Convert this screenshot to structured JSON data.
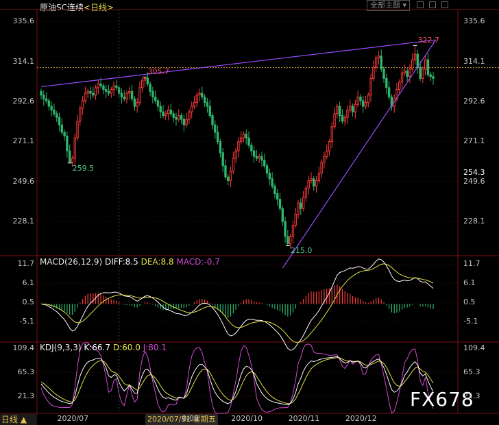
{
  "header": {
    "instrument": "原油SC连续",
    "period_tag": "<日线>",
    "theme_button": "全部主题",
    "dropdown_icon": "triangle-down-icon"
  },
  "colors": {
    "up": "#ff3b3b",
    "down": "#2eb86e",
    "trendline": "#9a4dff",
    "level_line": "#d39a2a",
    "axis_text": "#c8c8c8",
    "grid": "#3a1010",
    "macd_diff": "#ffffff",
    "macd_dea": "#e6e24a",
    "macd_hist_up": "#ff3b3b",
    "macd_hist_down": "#2eb86e",
    "kdj_k": "#ffffff",
    "kdj_d": "#e6e24a",
    "kdj_j": "#d04bd0",
    "current_price_label": "#ffffff"
  },
  "chart_data": [
    {
      "type": "candlestick",
      "panel": "price",
      "y_ticks": [
        "335.6",
        "314.1",
        "292.6",
        "271.1",
        "249.6",
        "228.1"
      ],
      "y_tick_values": [
        335.6,
        314.1,
        292.6,
        271.1,
        249.6,
        228.1
      ],
      "ylim": [
        210.0,
        342.0
      ],
      "current_price": "254.3",
      "reference_level": 310.8,
      "annotations": [
        {
          "text": "322.7",
          "value": 322.7,
          "kind": "high"
        },
        {
          "text": "305.7",
          "value": 305.7,
          "kind": "high"
        },
        {
          "text": "259.5",
          "value": 259.5,
          "kind": "low"
        },
        {
          "text": "215.0",
          "value": 215.0,
          "kind": "low"
        }
      ],
      "trendlines": [
        {
          "name": "upper",
          "from_index": 0,
          "from_value": 300.5,
          "to_index": 152,
          "to_value": 325.7
        },
        {
          "name": "lower",
          "from_index": 93,
          "from_value": 203.0,
          "to_index": 152,
          "to_value": 325.7
        }
      ],
      "close": [
        296,
        294,
        293,
        290,
        288,
        286,
        284,
        280,
        276,
        274,
        266,
        260,
        262,
        273,
        282,
        289,
        293,
        297,
        298,
        297,
        296,
        300,
        302,
        301,
        299,
        298,
        297,
        299,
        301,
        300,
        297,
        295,
        294,
        297,
        298,
        294,
        290,
        292,
        300,
        304,
        305,
        302,
        298,
        295,
        293,
        290,
        287,
        285,
        286,
        288,
        286,
        284,
        283,
        285,
        283,
        280,
        283,
        287,
        290,
        292,
        296,
        297,
        295,
        292,
        290,
        285,
        280,
        276,
        271,
        265,
        258,
        252,
        250,
        255,
        262,
        266,
        271,
        273,
        275,
        273,
        269,
        266,
        263,
        262,
        263,
        261,
        258,
        254,
        251,
        247,
        243,
        240,
        235,
        228,
        220,
        216,
        220,
        226,
        232,
        238,
        235,
        241,
        246,
        250,
        251,
        247,
        250,
        254,
        260,
        263,
        266,
        271,
        279,
        286,
        290,
        285,
        282,
        284,
        288,
        290,
        287,
        291,
        295,
        293,
        290,
        292,
        296,
        305,
        311,
        316,
        317,
        310,
        305,
        300,
        295,
        290,
        294,
        299,
        303,
        308,
        309,
        306,
        310,
        315,
        318,
        311,
        305,
        310,
        315,
        307,
        306,
        305
      ],
      "open": [
        298,
        296,
        294,
        293,
        290,
        288,
        286,
        284,
        280,
        276,
        274,
        266,
        260,
        262,
        273,
        282,
        289,
        293,
        297,
        298,
        297,
        296,
        300,
        302,
        301,
        299,
        298,
        297,
        299,
        301,
        300,
        297,
        295,
        294,
        297,
        298,
        294,
        290,
        292,
        300,
        304,
        305,
        302,
        298,
        295,
        293,
        290,
        287,
        285,
        286,
        288,
        286,
        284,
        283,
        285,
        283,
        280,
        283,
        287,
        290,
        292,
        296,
        297,
        295,
        292,
        290,
        285,
        280,
        276,
        271,
        265,
        258,
        252,
        250,
        255,
        262,
        266,
        271,
        273,
        275,
        273,
        269,
        266,
        263,
        262,
        263,
        261,
        258,
        254,
        251,
        247,
        243,
        240,
        235,
        228,
        220,
        216,
        220,
        226,
        232,
        238,
        235,
        241,
        246,
        250,
        251,
        247,
        250,
        254,
        260,
        263,
        266,
        271,
        279,
        286,
        290,
        285,
        282,
        284,
        288,
        290,
        287,
        291,
        295,
        293,
        290,
        292,
        296,
        305,
        311,
        316,
        317,
        310,
        305,
        300,
        295,
        290,
        294,
        299,
        303,
        308,
        309,
        306,
        310,
        315,
        318,
        311,
        305,
        310,
        315,
        307,
        306
      ],
      "low_overrides": [
        {
          "index": 11,
          "value": 259.5
        },
        {
          "index": 95,
          "value": 215.0
        }
      ],
      "high_overrides": [
        {
          "index": 40,
          "value": 305.7
        },
        {
          "index": 144,
          "value": 322.7
        }
      ]
    },
    {
      "type": "macd",
      "panel": "macd",
      "label": "MACD(26,12,9)",
      "diff_label": "DIFF:8.5",
      "dea_label": "DEA:8.8",
      "macd_label": "MACD:-0.7",
      "y_ticks": [
        "11.7",
        "6.1",
        "0.5",
        "-5.1"
      ],
      "y_tick_values": [
        11.7,
        6.1,
        0.5,
        -5.1
      ],
      "ylim": [
        -11.0,
        14.0
      ]
    },
    {
      "type": "kdj",
      "panel": "kdj",
      "label": "KDJ(9,3,3)",
      "k_label": "K:66.7",
      "d_label": "D:60.0",
      "j_label": "J:80.1",
      "y_ticks": [
        "109.4",
        "65.3",
        "21.3"
      ],
      "y_tick_values": [
        109.4,
        65.3,
        21.3
      ],
      "ylim": [
        -10.0,
        120.0
      ]
    }
  ],
  "x_axis": {
    "labels": [
      {
        "text": "2020/07",
        "index": 12
      },
      {
        "text": "0/09",
        "index": 60
      },
      {
        "text": "2020/10",
        "index": 79
      },
      {
        "text": "2020/11",
        "index": 101
      },
      {
        "text": "2020/12",
        "index": 123
      }
    ],
    "cursor_label": "2020/07/31 星期五",
    "cursor_index": 30
  },
  "footer": {
    "period_button": "日线 ▲"
  },
  "watermark": "FX678"
}
